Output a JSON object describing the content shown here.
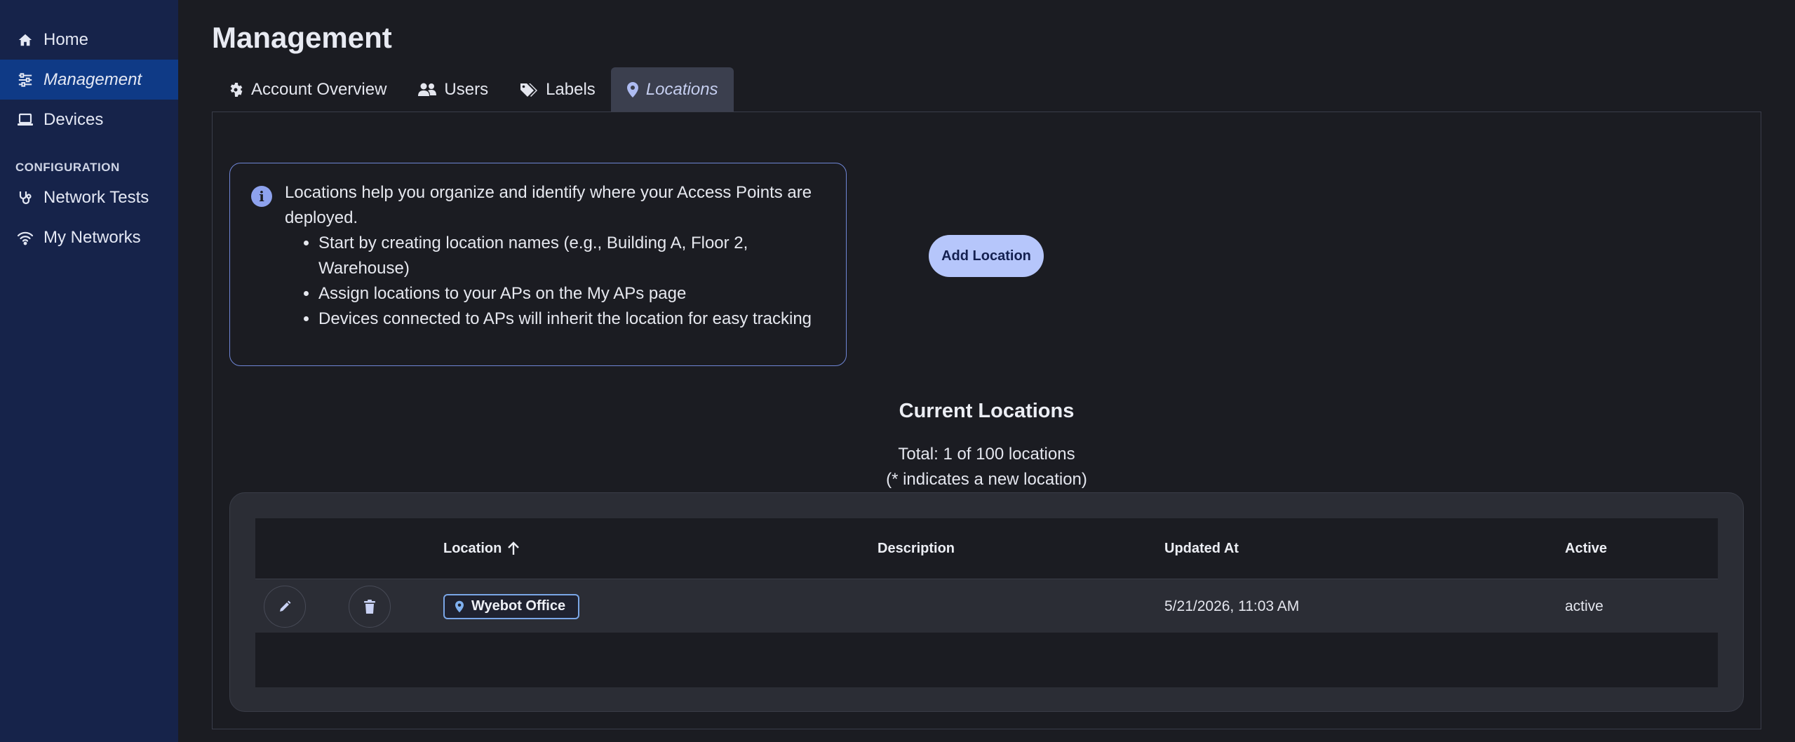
{
  "sidebar": {
    "items": [
      {
        "label": "Home",
        "icon": "home-icon"
      },
      {
        "label": "Management",
        "icon": "sliders-icon",
        "active": true
      },
      {
        "label": "Devices",
        "icon": "laptop-icon"
      }
    ],
    "section_label": "CONFIGURATION",
    "config_items": [
      {
        "label": "Network Tests",
        "icon": "stethoscope-icon"
      },
      {
        "label": "My Networks",
        "icon": "wifi-icon"
      }
    ]
  },
  "page": {
    "title": "Management"
  },
  "tabs": [
    {
      "label": "Account Overview",
      "icon": "gear-icon"
    },
    {
      "label": "Users",
      "icon": "users-icon"
    },
    {
      "label": "Labels",
      "icon": "tags-icon"
    },
    {
      "label": "Locations",
      "icon": "location-pin-icon",
      "active": true
    }
  ],
  "info": {
    "intro": "Locations help you organize and identify where your Access Points are deployed.",
    "bullets": [
      "Start by creating location names (e.g., Building A, Floor 2, Warehouse)",
      "Assign locations to your APs on the My APs page",
      "Devices connected to APs will inherit the location for easy tracking"
    ]
  },
  "actions": {
    "add_location": "Add Location"
  },
  "locations": {
    "title": "Current Locations",
    "total": "Total: 1 of 100 locations",
    "note": "(* indicates a new location)",
    "columns": {
      "location": "Location",
      "description": "Description",
      "updated_at": "Updated At",
      "active": "Active"
    },
    "rows": [
      {
        "location": "Wyebot Office",
        "description": "",
        "updated_at": "5/21/2026, 11:03 AM",
        "active": "active"
      }
    ]
  },
  "colors": {
    "sidebar_bg": "#16234a",
    "sidebar_active": "#0f3a86",
    "accent_button": "#b6c6fb",
    "info_border": "#6f86d6",
    "chip_border": "#7aa6e6"
  }
}
